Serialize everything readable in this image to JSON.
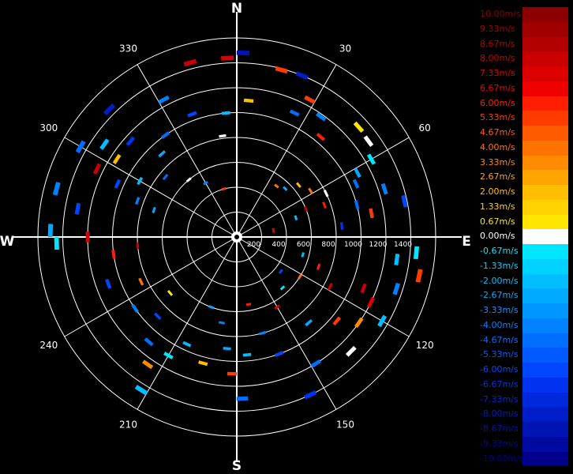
{
  "chart_data": {
    "type": "scatter",
    "subtype": "polar-doppler-velocity",
    "compass": {
      "north": "N",
      "east": "E",
      "south": "S",
      "west": "W"
    },
    "azimuth_labels": [
      "30",
      "60",
      "120",
      "150",
      "210",
      "240",
      "300",
      "330"
    ],
    "range_labels": [
      "200",
      "400",
      "600",
      "800",
      "1000",
      "1200",
      "1400"
    ],
    "radial_range": [
      0,
      1600
    ],
    "range_rings": [
      200,
      400,
      600,
      800,
      1000,
      1200,
      1400,
      1600
    ],
    "spokes_deg": [
      0,
      30,
      60,
      90,
      120,
      150,
      180,
      210,
      240,
      270,
      300,
      330
    ],
    "grid": true,
    "legend_position": "right",
    "velocity_scale": [
      {
        "label": "10.00m/s",
        "value": 10.0,
        "color": "#8c0000"
      },
      {
        "label": "9.33m/s",
        "value": 9.33,
        "color": "#a00000"
      },
      {
        "label": "8.67m/s",
        "value": 8.67,
        "color": "#b40000"
      },
      {
        "label": "8.00m/s",
        "value": 8.0,
        "color": "#c80000"
      },
      {
        "label": "7.33m/s",
        "value": 7.33,
        "color": "#dc0000"
      },
      {
        "label": "6.67m/s",
        "value": 6.67,
        "color": "#f00000"
      },
      {
        "label": "6.00m/s",
        "value": 6.0,
        "color": "#ff1e00"
      },
      {
        "label": "5.33m/s",
        "value": 5.33,
        "color": "#ff3c00"
      },
      {
        "label": "4.67m/s",
        "value": 4.67,
        "color": "#ff5a00"
      },
      {
        "label": "4.00m/s",
        "value": 4.0,
        "color": "#ff7300"
      },
      {
        "label": "3.33m/s",
        "value": 3.33,
        "color": "#ff8c00"
      },
      {
        "label": "2.67m/s",
        "value": 2.67,
        "color": "#ffa500"
      },
      {
        "label": "2.00m/s",
        "value": 2.0,
        "color": "#ffbe00"
      },
      {
        "label": "1.33m/s",
        "value": 1.33,
        "color": "#ffd200"
      },
      {
        "label": "0.67m/s",
        "value": 0.67,
        "color": "#ffe600"
      },
      {
        "label": "0.00m/s",
        "value": 0.0,
        "color": "#ffffff"
      },
      {
        "label": "-0.67m/s",
        "value": -0.67,
        "color": "#00e6ff"
      },
      {
        "label": "-1.33m/s",
        "value": -1.33,
        "color": "#00d2ff"
      },
      {
        "label": "-2.00m/s",
        "value": -2.0,
        "color": "#00beff"
      },
      {
        "label": "-2.67m/s",
        "value": -2.67,
        "color": "#00aaff"
      },
      {
        "label": "-3.33m/s",
        "value": -3.33,
        "color": "#0096ff"
      },
      {
        "label": "-4.00m/s",
        "value": -4.0,
        "color": "#0082ff"
      },
      {
        "label": "-4.67m/s",
        "value": -4.67,
        "color": "#006eff"
      },
      {
        "label": "-5.33m/s",
        "value": -5.33,
        "color": "#005aff"
      },
      {
        "label": "-6.00m/s",
        "value": -6.0,
        "color": "#0046ff"
      },
      {
        "label": "-6.67m/s",
        "value": -6.67,
        "color": "#0032f0"
      },
      {
        "label": "-7.33m/s",
        "value": -7.33,
        "color": "#0028dc"
      },
      {
        "label": "-8.00m/s",
        "value": -8.0,
        "color": "#001ec8"
      },
      {
        "label": "-8.67m/s",
        "value": -8.67,
        "color": "#0014b4"
      },
      {
        "label": "-9.33m/s",
        "value": -9.33,
        "color": "#000aa0"
      },
      {
        "label": "-10.00m/s",
        "value": -10.0,
        "color": "#00008c"
      }
    ],
    "gates": [
      {
        "az": 2,
        "range": 1480,
        "v": -9
      },
      {
        "az": 357,
        "range": 1440,
        "v": 7
      },
      {
        "az": 345,
        "range": 1450,
        "v": 8
      },
      {
        "az": 15,
        "range": 1390,
        "v": 5
      },
      {
        "az": 22,
        "range": 1400,
        "v": -8
      },
      {
        "az": 28,
        "range": 1250,
        "v": 5
      },
      {
        "az": 35,
        "range": 1180,
        "v": -4
      },
      {
        "az": 40,
        "range": 1050,
        "v": 6
      },
      {
        "az": 25,
        "range": 1100,
        "v": -5
      },
      {
        "az": 48,
        "range": 1320,
        "v": 1
      },
      {
        "az": 54,
        "range": 1310,
        "v": 0
      },
      {
        "az": 60,
        "range": 1250,
        "v": -0.5
      },
      {
        "az": 62,
        "range": 1100,
        "v": -3
      },
      {
        "az": 66,
        "range": 1050,
        "v": -5
      },
      {
        "az": 72,
        "range": 1250,
        "v": -4
      },
      {
        "az": 75,
        "range": 1000,
        "v": -5
      },
      {
        "az": 78,
        "range": 1380,
        "v": -6
      },
      {
        "az": 80,
        "range": 1100,
        "v": 5
      },
      {
        "az": 84,
        "range": 850,
        "v": -7
      },
      {
        "az": 70,
        "range": 750,
        "v": 6
      },
      {
        "az": 64,
        "range": 800,
        "v": 0
      },
      {
        "az": 68,
        "range": 600,
        "v": 8
      },
      {
        "az": 58,
        "range": 700,
        "v": 4
      },
      {
        "az": 50,
        "range": 650,
        "v": 2
      },
      {
        "az": 45,
        "range": 550,
        "v": -3
      },
      {
        "az": 38,
        "range": 520,
        "v": 4
      },
      {
        "az": 72,
        "range": 500,
        "v": -2
      },
      {
        "az": 80,
        "range": 300,
        "v": 7
      },
      {
        "az": 5,
        "range": 1100,
        "v": 2
      },
      {
        "az": 355,
        "range": 1000,
        "v": -2
      },
      {
        "az": 352,
        "range": 820,
        "v": 0
      },
      {
        "az": 340,
        "range": 1050,
        "v": -6
      },
      {
        "az": 332,
        "range": 1250,
        "v": -4
      },
      {
        "az": 325,
        "range": 1000,
        "v": -5
      },
      {
        "az": 318,
        "range": 900,
        "v": -3
      },
      {
        "az": 312,
        "range": 1150,
        "v": -7
      },
      {
        "az": 305,
        "range": 1300,
        "v": -2
      },
      {
        "az": 300,
        "range": 1450,
        "v": -5
      },
      {
        "az": 296,
        "range": 1250,
        "v": 8
      },
      {
        "az": 294,
        "range": 1050,
        "v": -6
      },
      {
        "az": 290,
        "range": 850,
        "v": -4
      },
      {
        "az": 288,
        "range": 700,
        "v": -3
      },
      {
        "az": 300,
        "range": 900,
        "v": -2
      },
      {
        "az": 303,
        "range": 1150,
        "v": 2
      },
      {
        "az": 310,
        "range": 750,
        "v": -5
      },
      {
        "az": 320,
        "range": 600,
        "v": 0
      },
      {
        "az": 330,
        "range": 500,
        "v": -4
      },
      {
        "az": 345,
        "range": 400,
        "v": 5
      },
      {
        "az": 315,
        "range": 1450,
        "v": -8
      },
      {
        "az": 285,
        "range": 1500,
        "v": -4
      },
      {
        "az": 280,
        "range": 1300,
        "v": -6
      },
      {
        "az": 270,
        "range": 1200,
        "v": 7
      },
      {
        "az": 272,
        "range": 1500,
        "v": -3
      },
      {
        "az": 265,
        "range": 800,
        "v": 8
      },
      {
        "az": 262,
        "range": 1000,
        "v": 6
      },
      {
        "az": 268,
        "range": 1450,
        "v": -1
      },
      {
        "az": 95,
        "range": 1450,
        "v": -1
      },
      {
        "az": 98,
        "range": 1300,
        "v": -2
      },
      {
        "az": 102,
        "range": 1500,
        "v": 5
      },
      {
        "az": 108,
        "range": 1350,
        "v": -4
      },
      {
        "az": 112,
        "range": 1100,
        "v": 8
      },
      {
        "az": 116,
        "range": 1200,
        "v": 7
      },
      {
        "az": 120,
        "range": 1350,
        "v": -2
      },
      {
        "az": 125,
        "range": 1200,
        "v": 3
      },
      {
        "az": 130,
        "range": 1050,
        "v": 5
      },
      {
        "az": 135,
        "range": 1300,
        "v": 0
      },
      {
        "az": 140,
        "range": 900,
        "v": -3
      },
      {
        "az": 118,
        "range": 850,
        "v": 8
      },
      {
        "az": 110,
        "range": 700,
        "v": 6
      },
      {
        "az": 105,
        "range": 550,
        "v": -2
      },
      {
        "az": 122,
        "range": 600,
        "v": 4
      },
      {
        "az": 128,
        "range": 450,
        "v": -6
      },
      {
        "az": 148,
        "range": 1200,
        "v": -5
      },
      {
        "az": 155,
        "range": 1400,
        "v": -7
      },
      {
        "az": 160,
        "range": 1000,
        "v": -6
      },
      {
        "az": 165,
        "range": 800,
        "v": -4
      },
      {
        "az": 175,
        "range": 950,
        "v": -2
      },
      {
        "az": 178,
        "range": 1300,
        "v": -5
      },
      {
        "az": 182,
        "range": 1100,
        "v": 5
      },
      {
        "az": 185,
        "range": 900,
        "v": -3
      },
      {
        "az": 190,
        "range": 700,
        "v": -4
      },
      {
        "az": 195,
        "range": 1050,
        "v": 2
      },
      {
        "az": 205,
        "range": 950,
        "v": -2
      },
      {
        "az": 210,
        "range": 1100,
        "v": -1
      },
      {
        "az": 212,
        "range": 1450,
        "v": -2
      },
      {
        "az": 215,
        "range": 1250,
        "v": 3
      },
      {
        "az": 220,
        "range": 1100,
        "v": -5
      },
      {
        "az": 225,
        "range": 900,
        "v": -6
      },
      {
        "az": 230,
        "range": 700,
        "v": 1
      },
      {
        "az": 235,
        "range": 1000,
        "v": -4
      },
      {
        "az": 245,
        "range": 850,
        "v": 4
      },
      {
        "az": 250,
        "range": 1100,
        "v": -6
      },
      {
        "az": 200,
        "range": 600,
        "v": -3
      },
      {
        "az": 170,
        "range": 550,
        "v": 6
      },
      {
        "az": 150,
        "range": 650,
        "v": 7
      },
      {
        "az": 138,
        "range": 550,
        "v": -1
      }
    ]
  }
}
